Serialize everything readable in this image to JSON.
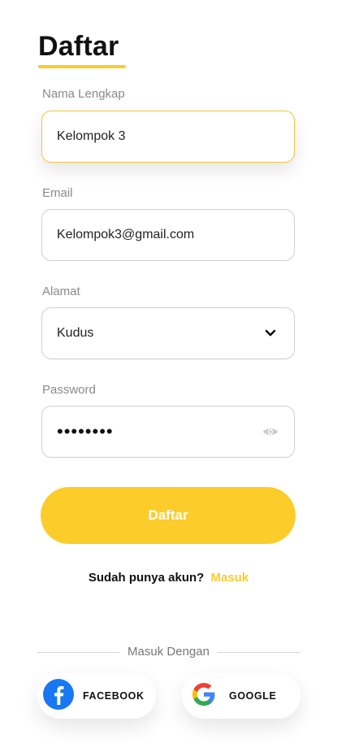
{
  "title": "Daftar",
  "fields": {
    "name": {
      "label": "Nama Lengkap",
      "value": "Kelompok 3"
    },
    "email": {
      "label": "Email",
      "value": "Kelompok3@gmail.com"
    },
    "address": {
      "label": "Alamat",
      "value": "Kudus"
    },
    "password": {
      "label": "Password",
      "value": "••••••••"
    }
  },
  "submit_label": "Daftar",
  "signin": {
    "prompt": "Sudah punya akun?",
    "link": "Masuk"
  },
  "divider_text": "Masuk Dengan",
  "social": {
    "facebook": "FACEBOOK",
    "google": "GOOGLE"
  },
  "colors": {
    "accent": "#FCCC2B",
    "facebook": "#1877F2"
  },
  "icons": {
    "address_trailing": "chevron-down-icon",
    "password_trailing": "eye-icon"
  }
}
